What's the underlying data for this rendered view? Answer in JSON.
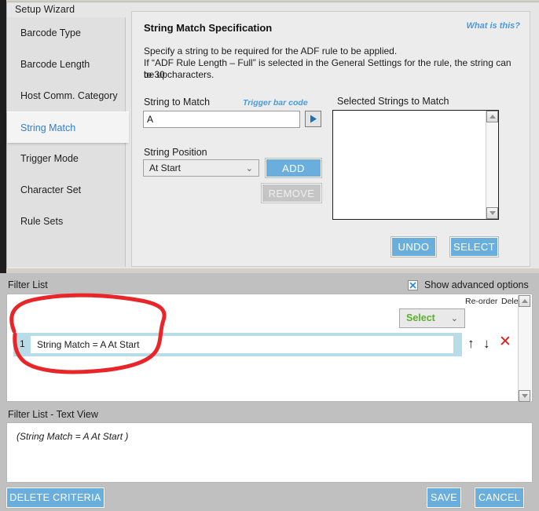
{
  "window": {
    "title": "Setup Wizard"
  },
  "sidebar": {
    "items": [
      {
        "label": "Barcode Type",
        "selected": false
      },
      {
        "label": "Barcode Length",
        "selected": false
      },
      {
        "label": "Host Comm. Category",
        "selected": false
      },
      {
        "label": "String Match",
        "selected": true
      },
      {
        "label": "Trigger Mode",
        "selected": false
      },
      {
        "label": "Character Set",
        "selected": false
      },
      {
        "label": "Rule Sets",
        "selected": false
      }
    ]
  },
  "spec_panel": {
    "title": "String Match Specification",
    "help_link": "What is this?",
    "description_line1": "Specify a string to be required for the ADF rule to be applied.",
    "description_line2": "If “ADF Rule Length – Full” is selected in the General Settings for the rule, the string can be up",
    "description_line3": "to 30 characters.",
    "string_to_match_label": "String to Match",
    "trigger_barcode_link": "Trigger bar code",
    "string_to_match_value": "A",
    "string_to_match_placeholder": "",
    "play_icon": "play-icon",
    "string_position_label": "String Position",
    "string_position_value": "At Start",
    "string_position_options": [
      "At Start"
    ],
    "chevron_glyph": "⌄",
    "add_label": "ADD",
    "remove_label": "REMOVE",
    "selected_strings_label": "Selected Strings to Match",
    "selected_strings_items": [],
    "undo_label": "UNDO",
    "select_label": "SELECT"
  },
  "filter_list": {
    "label": "Filter List",
    "show_advanced_label": "Show advanced options",
    "show_advanced_checked": true,
    "checkbox_glyph": "x-mark-icon",
    "col_reorder": "Re-order",
    "col_delete": "Delete",
    "select_dropdown_value": "Select",
    "select_dropdown_options": [
      "Select"
    ],
    "rows": [
      {
        "index": "1",
        "text": "String Match = A At Start"
      }
    ],
    "move_up_glyph": "↑",
    "move_down_glyph": "↓",
    "delete_glyph": "✕"
  },
  "text_view": {
    "label": "Filter List - Text View",
    "content": "(String Match = A At Start )"
  },
  "actions": {
    "delete_criteria_label": "DELETE CRITERIA",
    "save_label": "SAVE",
    "cancel_label": "CANCEL"
  },
  "colors": {
    "accent_blue": "#6aaedd",
    "link_blue": "#4a9ade",
    "row_highlight": "#b8dde8",
    "green_text": "#5cb030",
    "delete_red": "#e21b1b",
    "annotation_red": "#e8262a",
    "panel_bg": "#ececec",
    "window_bg": "#c0c0c0"
  }
}
